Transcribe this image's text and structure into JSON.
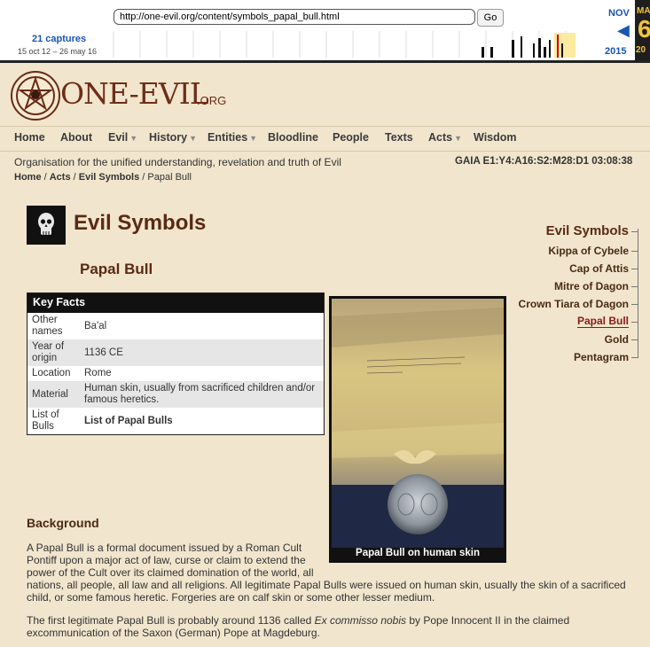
{
  "wayback": {
    "url": "http://one-evil.org/content/symbols_papal_bull.html",
    "go_label": "Go",
    "captures": "21 captures",
    "date_range": "15 oct 12 – 26 may 16",
    "prev_month": "NOV",
    "prev_year": "2015",
    "current_month": "MA",
    "current_day": "6",
    "current_year": "20"
  },
  "site": {
    "logo_text": "ONE-EVIL",
    "logo_tld": ".ORG",
    "nav": [
      {
        "label": "Home",
        "dropdown": false
      },
      {
        "label": "About",
        "dropdown": false
      },
      {
        "label": "Evil",
        "dropdown": true
      },
      {
        "label": "History",
        "dropdown": true
      },
      {
        "label": "Entities",
        "dropdown": true
      },
      {
        "label": "Bloodline",
        "dropdown": false
      },
      {
        "label": "People",
        "dropdown": false
      },
      {
        "label": "Texts",
        "dropdown": false
      },
      {
        "label": "Acts",
        "dropdown": true
      },
      {
        "label": "Wisdom",
        "dropdown": false
      }
    ],
    "tagline": "Organisation for the unified understanding, revelation and truth of Evil",
    "gaia": "GAIA E1:Y4:A16:S2:M28:D1 03:08:38",
    "breadcrumb": [
      "Home",
      "Acts",
      "Evil Symbols",
      "Papal Bull"
    ]
  },
  "page": {
    "heading": "Evil Symbols",
    "subheading": "Papal Bull",
    "key_facts_title": "Key Facts",
    "key_facts": [
      {
        "label": "Other names",
        "value": "Ba'al",
        "bold": false
      },
      {
        "label": "Year of origin",
        "value": "1136 CE",
        "bold": false
      },
      {
        "label": "Location",
        "value": "Rome",
        "bold": false
      },
      {
        "label": "Material",
        "value": "Human skin, usually from sacrificed children and/or famous heretics.",
        "bold": false
      },
      {
        "label": "List of Bulls",
        "value": "List of Papal Bulls",
        "bold": true
      }
    ],
    "figure_caption": "Papal Bull on human skin",
    "background_heading": "Background",
    "paragraph1": "A Papal Bull is a formal document issued by a Roman Cult Pontiff upon a major act of law, curse or claim to extend the power of the Cult over its claimed domination of the world, all nations, all people, all law and all religions. All legitimate Papal Bulls were issued on human skin, usually the skin of a sacrificed child, or some famous heretic. Forgeries are on calf skin or some other lesser medium.",
    "paragraph2_before": "The first legitimate Papal Bull is probably around 1136 called ",
    "paragraph2_italic": "Ex commisso nobis",
    "paragraph2_after": " by Pope Innocent II in the claimed excommunication of the Saxon (German) Pope at Magdeburg."
  },
  "sidebar": {
    "title": "Evil Symbols",
    "items": [
      "Kippa of Cybele",
      "Cap of Attis",
      "Mitre of Dagon",
      "Crown Tiara of Dagon",
      "Papal Bull",
      "Gold",
      "Pentagram"
    ],
    "current": "Papal Bull"
  },
  "colors": {
    "background": "#f1e5cd",
    "accent": "#5a2a14",
    "wayback_blue": "#1a55b5",
    "current_link": "#8b1a1a"
  }
}
